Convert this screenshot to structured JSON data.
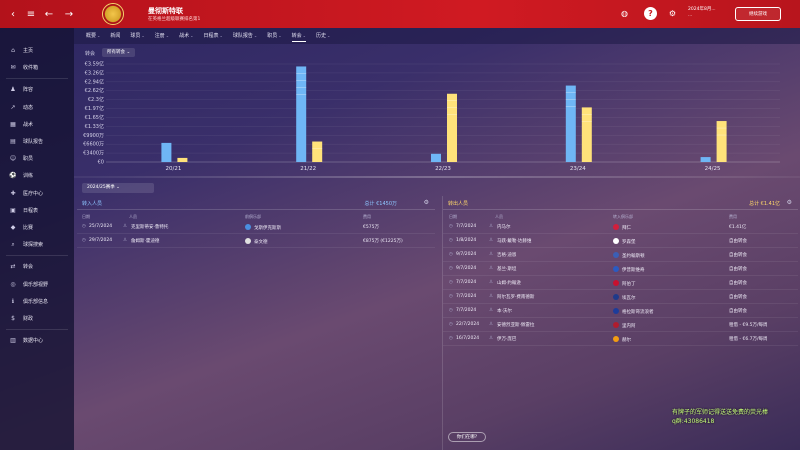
{
  "header": {
    "club_name": "曼彻斯特联",
    "club_subtitle": "在英格兰超级联赛排名第1",
    "date_line1": "2024年8月...",
    "date_line2": "...",
    "continue_label": "继续游戏",
    "brand_colors": {
      "topbar": "#c8161e",
      "incoming": "#6fb6f5",
      "outgoing": "#ffe27a"
    }
  },
  "sidebar": {
    "items": [
      {
        "label": "主页",
        "icon": "home-icon",
        "glyph": "⌂"
      },
      {
        "label": "收件箱",
        "icon": "inbox-icon",
        "glyph": "✉"
      },
      {
        "label": "阵容",
        "icon": "squad-icon",
        "glyph": "♟"
      },
      {
        "label": "动态",
        "icon": "dynamics-icon",
        "glyph": "↗"
      },
      {
        "label": "战术",
        "icon": "tactics-icon",
        "glyph": "▦"
      },
      {
        "label": "球队报告",
        "icon": "report-icon",
        "glyph": "▤"
      },
      {
        "label": "职员",
        "icon": "staff-icon",
        "glyph": "☺"
      },
      {
        "label": "训练",
        "icon": "training-icon",
        "glyph": "⚽"
      },
      {
        "label": "医疗中心",
        "icon": "medical-icon",
        "glyph": "✚"
      },
      {
        "label": "日程表",
        "icon": "calendar-icon",
        "glyph": "▣"
      },
      {
        "label": "比赛",
        "icon": "match-icon",
        "glyph": "◆"
      },
      {
        "label": "球探搜索",
        "icon": "scouting-icon",
        "glyph": "⌕"
      },
      {
        "label": "转会",
        "icon": "transfer-icon",
        "glyph": "⇄"
      },
      {
        "label": "俱乐部视野",
        "icon": "vision-icon",
        "glyph": "◎"
      },
      {
        "label": "俱乐部信息",
        "icon": "club-info-icon",
        "glyph": "ℹ"
      },
      {
        "label": "财政",
        "icon": "finance-icon",
        "glyph": "$"
      },
      {
        "label": "数据中心",
        "icon": "data-hub-icon",
        "glyph": "▥"
      }
    ]
  },
  "subnav": {
    "tabs": [
      {
        "label": "概要",
        "chev": true
      },
      {
        "label": "新闻",
        "chev": false
      },
      {
        "label": "球员",
        "chev": true
      },
      {
        "label": "注册",
        "chev": true
      },
      {
        "label": "战术",
        "chev": true
      },
      {
        "label": "日程表",
        "chev": true
      },
      {
        "label": "球队报告",
        "chev": true
      },
      {
        "label": "职员",
        "chev": true
      },
      {
        "label": "转会",
        "chev": true,
        "active": true
      },
      {
        "label": "历史",
        "chev": true
      }
    ]
  },
  "chart_label": "转会",
  "chart_filter": "所有转会",
  "chart_data": {
    "type": "bar",
    "categories": [
      "20/21",
      "21/22",
      "22/23",
      "23/24",
      "24/25"
    ],
    "y_ticks": [
      "€3.59亿",
      "€3.26亿",
      "€2.94亿",
      "€2.62亿",
      "€2.3亿",
      "€1.97亿",
      "€1.65亿",
      "€1.33亿",
      "€9900万",
      "€6600万",
      "€3400万",
      "€0"
    ],
    "ylim": [
      0,
      359
    ],
    "series": [
      {
        "values": [
          70,
          350,
          30,
          280,
          18
        ]
      },
      {
        "values": [
          15,
          75,
          250,
          200,
          150
        ]
      }
    ],
    "grid": true
  },
  "season_select": "2024/25赛季",
  "incoming": {
    "title": "转入人员",
    "total": "总计 €1450万",
    "columns": [
      "日期",
      "人员",
      "前俱乐部",
      "费用"
    ],
    "rows": [
      {
        "date": "25/7/2024",
        "player": "克里斯蒂安·鲁特托",
        "club": "戈斯伊克斯斯",
        "fee": "€575万",
        "club_color": "#4a8fe0"
      },
      {
        "date": "29/7/2024",
        "player": "詹姆斯·霍迪德",
        "club": "泰文德",
        "fee": "€875万 (€1225万)",
        "club_color": "#e0e0e0"
      }
    ]
  },
  "outgoing": {
    "title": "转出人员",
    "total": "总计 €1.41亿",
    "columns": [
      "日期",
      "人员",
      "转入俱乐部",
      "费用"
    ],
    "rows": [
      {
        "date": "7/7/2024",
        "player": "内马尔",
        "club": "拜仁",
        "fee": "€1.41亿",
        "club_color": "#d21f3c"
      },
      {
        "date": "1/8/2024",
        "player": "马跃·戴勒·达赫维",
        "club": "罗森堡",
        "fee": "自由转会",
        "club_color": "#ffffff"
      },
      {
        "date": "9/7/2024",
        "player": "吉格·迪恩",
        "club": "圣约翰斯顿",
        "fee": "自由转会",
        "club_color": "#3b5fb5"
      },
      {
        "date": "9/7/2024",
        "player": "基兰·斯坦",
        "club": "伊普斯维奇",
        "fee": "自由转会",
        "club_color": "#2a5bc2"
      },
      {
        "date": "7/7/2024",
        "player": "山姆·约翰逊",
        "club": "阿伯丁",
        "fee": "自由转会",
        "club_color": "#c8102e"
      },
      {
        "date": "7/7/2024",
        "player": "阿尔瓦罗·费南德斯",
        "club": "埃瓦尔",
        "fee": "自由转会",
        "club_color": "#1f3a8a"
      },
      {
        "date": "7/7/2024",
        "player": "本·沃尔",
        "club": "格拉斯哥流浪者",
        "fee": "自由转会",
        "club_color": "#1d3c9a"
      },
      {
        "date": "22/7/2024",
        "player": "安德烈亚斯·佩雷拉",
        "club": "里内阿",
        "fee": "租借 - €9.5万/每周",
        "club_color": "#b01c2e"
      },
      {
        "date": "16/7/2024",
        "player": "伊万·庞巴",
        "club": "赫尔",
        "fee": "租借 - €6.7万/每周",
        "club_color": "#f39c12"
      }
    ]
  },
  "notice_btn": "你们在哪?",
  "watermark": {
    "line1": "有牌子的军师记得送送免费的荧光棒",
    "line2": "q群:43086418"
  }
}
